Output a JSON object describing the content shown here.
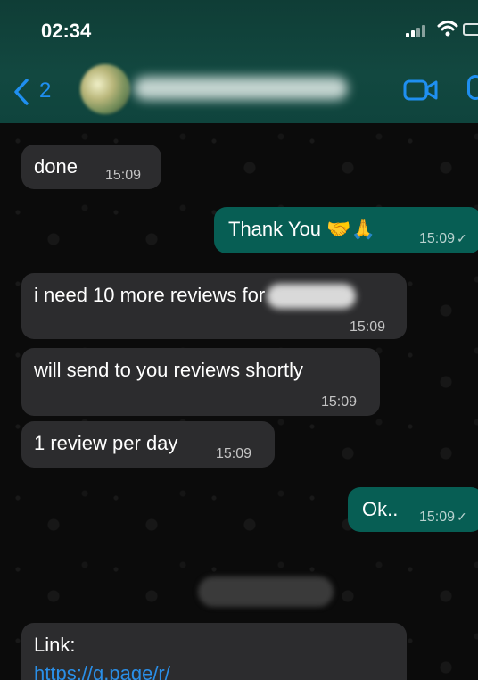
{
  "status_bar": {
    "time": "02:34"
  },
  "header": {
    "back_count": "2"
  },
  "messages": [
    {
      "direction": "in",
      "text": "done",
      "time": "15:09"
    },
    {
      "direction": "out",
      "text": "Thank You 🤝🙏",
      "time": "15:09"
    },
    {
      "direction": "in",
      "text": "i need 10 more reviews for",
      "time": "15:09"
    },
    {
      "direction": "in",
      "text": "will send to you reviews shortly",
      "time": "15:09"
    },
    {
      "direction": "in",
      "text": "1 review per day",
      "time": "15:09"
    },
    {
      "direction": "out",
      "text": "Ok..",
      "time": "15:09"
    },
    {
      "direction": "in",
      "label": "Link:",
      "link": "https://g.page/r/"
    }
  ],
  "colors": {
    "incoming": "#2c2c2e",
    "outgoing": "#075e54",
    "accent": "#1f8ff0",
    "link": "#2a8fe8"
  },
  "icons": [
    "chevron-left-icon",
    "video-call-icon",
    "signal-icon",
    "wifi-icon",
    "battery-icon"
  ]
}
